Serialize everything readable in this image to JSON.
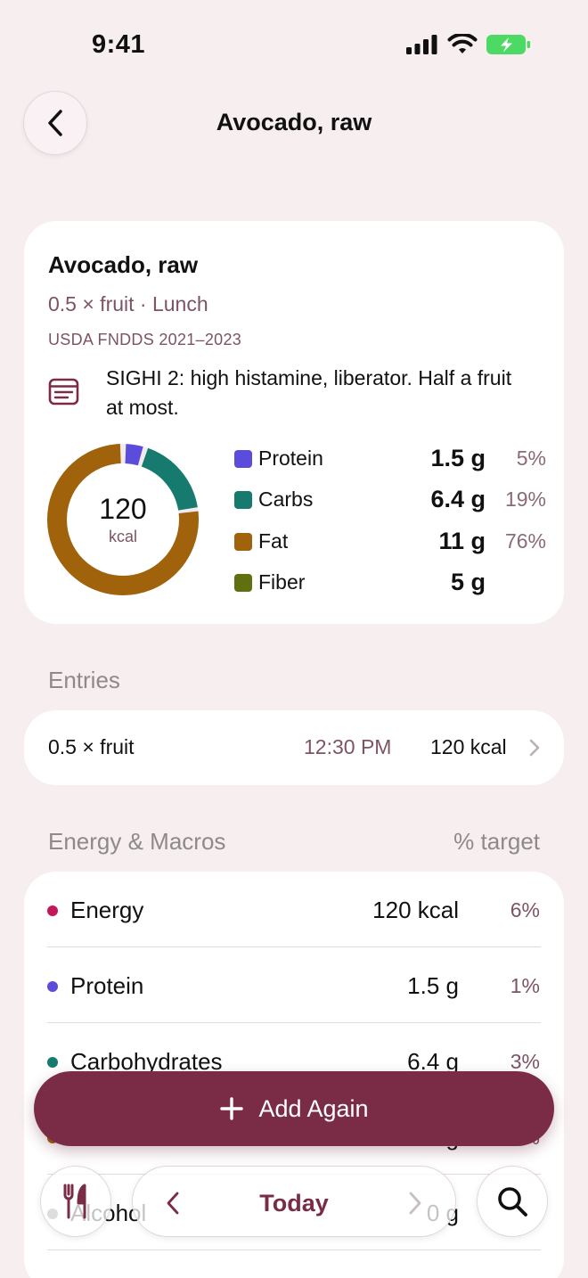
{
  "status_bar": {
    "time": "9:41"
  },
  "header": {
    "title": "Avocado, raw"
  },
  "summary": {
    "food_name": "Avocado, raw",
    "serving": "0.5 × fruit · Lunch",
    "source": "USDA FNDDS 2021–2023",
    "note": "SIGHI 2: high histamine, liberator. Half a fruit at most.",
    "calories": "120",
    "calories_unit": "kcal",
    "macros": [
      {
        "name": "Protein",
        "grams": "1.5 g",
        "pct": "5%",
        "color": "#5b4cdb"
      },
      {
        "name": "Carbs",
        "grams": "6.4 g",
        "pct": "19%",
        "color": "#167a6e"
      },
      {
        "name": "Fat",
        "grams": "11 g",
        "pct": "76%",
        "color": "#a0620a"
      },
      {
        "name": "Fiber",
        "grams": "5 g",
        "pct": "",
        "color": "#5e7010"
      }
    ]
  },
  "entries": {
    "title": "Entries",
    "items": [
      {
        "quantity": "0.5 × fruit",
        "time": "12:30 PM",
        "kcal": "120 kcal"
      }
    ]
  },
  "energy_macros": {
    "title": "Energy & Macros",
    "right_label": "% target",
    "rows": [
      {
        "name": "Energy",
        "value": "120 kcal",
        "pct": "6%",
        "color": "#c2185b"
      },
      {
        "name": "Protein",
        "value": "1.5 g",
        "pct": "1%",
        "color": "#5b4cdb"
      },
      {
        "name": "Carbohydrates",
        "value": "6.4 g",
        "pct": "3%",
        "color": "#167a6e"
      },
      {
        "name": "Fat",
        "value": "11 g",
        "pct": "14%",
        "color": "#a0620a"
      },
      {
        "name": "Alcohol",
        "value": "0 g",
        "pct": "",
        "color": "#7a7a7a"
      }
    ]
  },
  "actions": {
    "add_again": "Add Again"
  },
  "bottom_bar": {
    "date_label": "Today"
  },
  "icons": {
    "back": "chevron-left-icon",
    "note": "note-icon",
    "add": "plus-icon",
    "food": "fork-knife-icon",
    "search": "search-icon"
  }
}
